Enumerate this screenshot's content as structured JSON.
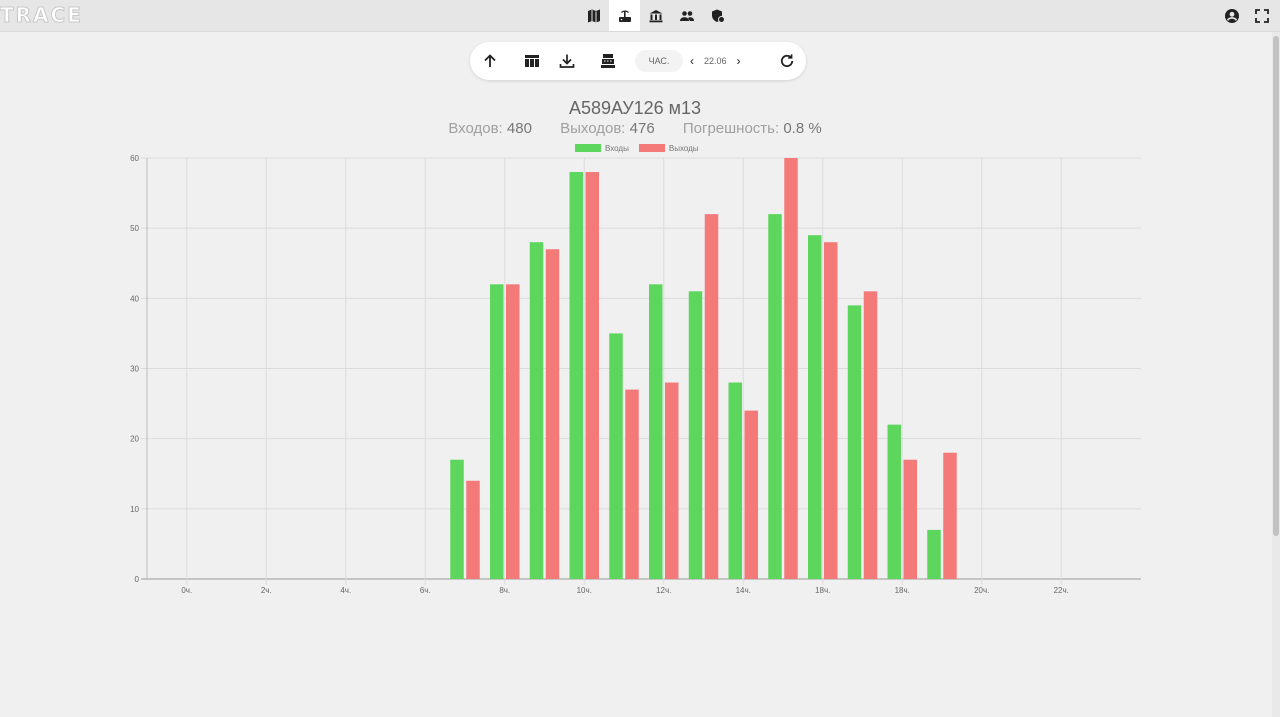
{
  "app": {
    "logo": "TRACE"
  },
  "nav": {
    "items": [
      {
        "name": "map-icon",
        "active": false
      },
      {
        "name": "router-icon",
        "active": true
      },
      {
        "name": "bank-icon",
        "active": false
      },
      {
        "name": "people-icon",
        "active": false
      },
      {
        "name": "shield-icon",
        "active": false
      }
    ]
  },
  "toolbar": {
    "period": "ЧАС.",
    "date": "22.06",
    "prev": "‹",
    "next": "›"
  },
  "header": {
    "title": "А589АУ126 м13",
    "entries_label": "Входов:",
    "entries_value": "480",
    "exits_label": "Выходов:",
    "exits_value": "476",
    "error_label": "Погрешность:",
    "error_value": "0.8 %"
  },
  "colors": {
    "entries": "#5dd65d",
    "exits": "#f47a7a"
  },
  "chart_data": {
    "type": "bar",
    "x": [
      0,
      1,
      2,
      3,
      4,
      5,
      6,
      7,
      8,
      9,
      10,
      11,
      12,
      13,
      14,
      15,
      16,
      17,
      18,
      19,
      20,
      21,
      22,
      23
    ],
    "tick_labels": [
      "0ч.",
      "2ч.",
      "4ч.",
      "6ч.",
      "8ч.",
      "10ч.",
      "12ч.",
      "14ч.",
      "18ч.",
      "18ч.",
      "20ч.",
      "22ч."
    ],
    "tick_positions": [
      0,
      2,
      4,
      6,
      8,
      10,
      12,
      14,
      16,
      18,
      20,
      22
    ],
    "series": [
      {
        "name": "Входы",
        "values": [
          0,
          0,
          0,
          0,
          0,
          0,
          0,
          17,
          42,
          48,
          58,
          35,
          42,
          41,
          28,
          52,
          49,
          39,
          22,
          7,
          0,
          0,
          0,
          0
        ]
      },
      {
        "name": "Выходы",
        "values": [
          0,
          0,
          0,
          0,
          0,
          0,
          0,
          14,
          42,
          47,
          58,
          27,
          28,
          52,
          24,
          60,
          48,
          41,
          17,
          18,
          0,
          0,
          0,
          0
        ]
      }
    ],
    "ylim": [
      0,
      60
    ],
    "yticks": [
      0,
      10,
      20,
      30,
      40,
      50,
      60
    ],
    "grid": true,
    "legend": "top-center"
  }
}
